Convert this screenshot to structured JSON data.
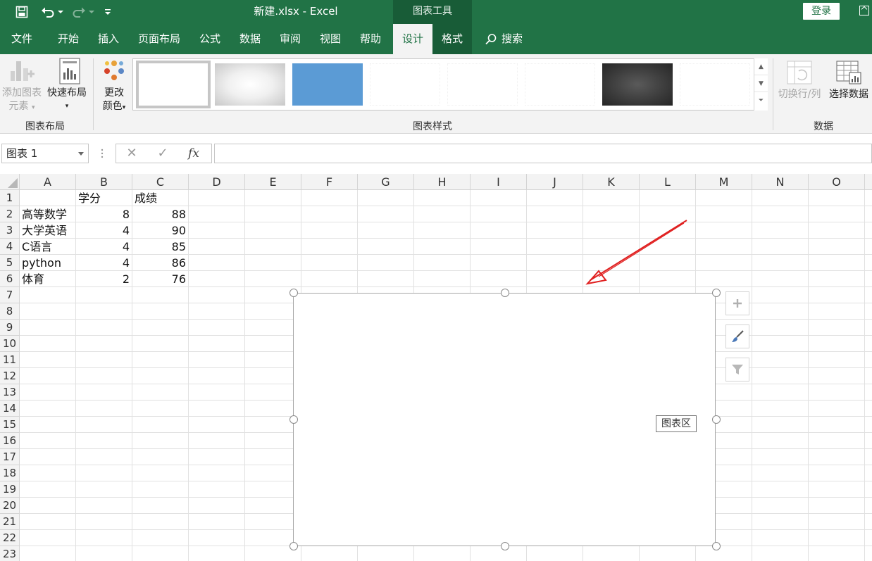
{
  "titlebar": {
    "doc_title": "新建.xlsx  -  Excel",
    "chart_tools": "图表工具",
    "login": "登录"
  },
  "tabs": [
    {
      "label": "文件"
    },
    {
      "label": "开始"
    },
    {
      "label": "插入"
    },
    {
      "label": "页面布局"
    },
    {
      "label": "公式"
    },
    {
      "label": "数据"
    },
    {
      "label": "审阅"
    },
    {
      "label": "视图"
    },
    {
      "label": "帮助"
    },
    {
      "label": "设计"
    },
    {
      "label": "格式"
    },
    {
      "label": "搜索"
    }
  ],
  "ribbon": {
    "add_element_1": "添加图表",
    "add_element_2": "元素",
    "quick_layout": "快速布局",
    "change_colors_1": "更改",
    "change_colors_2": "颜色",
    "group_chart_layout": "图表布局",
    "group_chart_styles": "图表样式",
    "switch_row_col": "切换行/列",
    "select_data": "选择数据",
    "group_data": "数据"
  },
  "formula_bar": {
    "name_box": "图表 1",
    "cancel": "✕",
    "enter": "✓",
    "fx": "fx",
    "formula": ""
  },
  "columns": [
    "A",
    "B",
    "C",
    "D",
    "E",
    "F",
    "G",
    "H",
    "I",
    "J",
    "K",
    "L",
    "M",
    "N",
    "O"
  ],
  "rows": [
    "1",
    "2",
    "3",
    "4",
    "5",
    "6",
    "7",
    "8",
    "9",
    "10",
    "11",
    "12",
    "13",
    "14",
    "15",
    "16",
    "17",
    "18",
    "19",
    "20",
    "21",
    "22",
    "23"
  ],
  "table": {
    "header": [
      "",
      "学分",
      "成绩"
    ],
    "data": [
      [
        "高等数学",
        "8",
        "88"
      ],
      [
        "大学英语",
        "4",
        "90"
      ],
      [
        "C语言",
        "4",
        "85"
      ],
      [
        "python",
        "4",
        "86"
      ],
      [
        "体育",
        "2",
        "76"
      ]
    ]
  },
  "chart": {
    "tooltip": "图表区",
    "side_buttons": [
      "plus-icon",
      "brush-icon",
      "filter-icon"
    ]
  },
  "colors": {
    "excel_green": "#217346",
    "dark_green": "#185c37",
    "arrow_red": "#e02020"
  }
}
